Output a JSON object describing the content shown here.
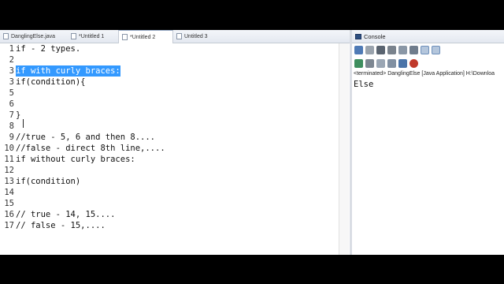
{
  "editor": {
    "tabs": [
      {
        "label": "DanglingElse.java",
        "active": false
      },
      {
        "label": "*Untitled 1",
        "active": false
      },
      {
        "label": "*Untitled 2",
        "active": true
      },
      {
        "label": "Untitled 3",
        "active": false
      }
    ],
    "lines": [
      {
        "num": "1",
        "text": "if - 2 types."
      },
      {
        "num": "2",
        "text": ""
      },
      {
        "num": "3",
        "text": "if with curly braces:"
      },
      {
        "num": "3",
        "text": "if(condition){"
      },
      {
        "num": "5",
        "text": ""
      },
      {
        "num": "6",
        "text": ""
      },
      {
        "num": "7",
        "text": "}"
      },
      {
        "num": "8",
        "text": ""
      },
      {
        "num": "9",
        "text": "//true - 5, 6 and then 8...."
      },
      {
        "num": "10",
        "text": "//false - direct 8th line,...."
      },
      {
        "num": "11",
        "text": "if without curly braces:"
      },
      {
        "num": "12",
        "text": ""
      },
      {
        "num": "13",
        "text": "if(condition)"
      },
      {
        "num": "14",
        "text": ""
      },
      {
        "num": "15",
        "text": ""
      },
      {
        "num": "16",
        "text": "// true - 14, 15...."
      },
      {
        "num": "17",
        "text": "// false - 15,...."
      }
    ]
  },
  "console": {
    "tab_label": "Console",
    "status": "<terminated> DanglingElse [Java Application] H:\\Downloa",
    "output": "Else",
    "toolbar_icons": [
      "pin-icon",
      "clear-console-icon",
      "terminate-icon",
      "remove-launch-icon",
      "scroll-lock-icon",
      "word-wrap-icon",
      "display-selected-icon",
      "open-console-icon"
    ],
    "colors": {
      "accent": "#3399ff",
      "icon_blue": "#2d4f80"
    }
  }
}
